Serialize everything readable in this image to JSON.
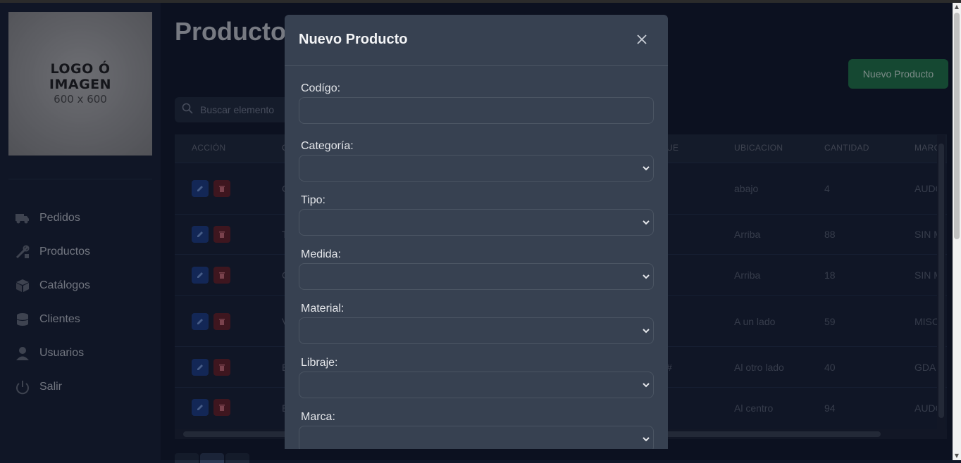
{
  "sidebar": {
    "logo": {
      "line1": "LOGO Ó",
      "line2": "IMAGEN",
      "line3": "600 x 600"
    },
    "items": [
      {
        "label": "Pedidos",
        "icon": "truck-icon"
      },
      {
        "label": "Productos",
        "icon": "tools-icon"
      },
      {
        "label": "Catálogos",
        "icon": "box-icon"
      },
      {
        "label": "Clientes",
        "icon": "database-icon"
      },
      {
        "label": "Usuarios",
        "icon": "user-icon"
      },
      {
        "label": "Salir",
        "icon": "power-icon"
      }
    ]
  },
  "main": {
    "title": "Productos",
    "new_button": "Nuevo Producto",
    "search_placeholder": "Buscar elemento",
    "columns": {
      "accion": "ACCIÓN",
      "c": "C",
      "ue": "UE",
      "ubicacion": "UBICACION",
      "cantidad": "CANTIDAD",
      "marca": "MARC"
    },
    "rows": [
      {
        "c": "C",
        "ue": "",
        "ubicacion": "abajo",
        "cantidad": "4",
        "marca": "AUDC"
      },
      {
        "c": "T",
        "ue": "",
        "ubicacion": "Arriba",
        "cantidad": "88",
        "marca": "SIN M"
      },
      {
        "c": "C",
        "ue": "",
        "ubicacion": "Arriba",
        "cantidad": "18",
        "marca": "SIN M"
      },
      {
        "c": "V",
        "ue": "",
        "ubicacion": "A un lado",
        "cantidad": "59",
        "marca": "MISC"
      },
      {
        "c": "E",
        "ue": "#",
        "ubicacion": "Al otro lado",
        "cantidad": "40",
        "marca": "GDA"
      },
      {
        "c": "E",
        "ue": "",
        "ubicacion": "Al centro",
        "cantidad": "94",
        "marca": "AUDC"
      }
    ]
  },
  "modal": {
    "title": "Nuevo Producto",
    "fields": [
      {
        "label": "Codígo:",
        "type": "text",
        "value": ""
      },
      {
        "label": "Categoría:",
        "type": "select",
        "value": ""
      },
      {
        "label": "Tipo:",
        "type": "select",
        "value": ""
      },
      {
        "label": "Medida:",
        "type": "select",
        "value": ""
      },
      {
        "label": "Material:",
        "type": "select",
        "value": ""
      },
      {
        "label": "Libraje:",
        "type": "select",
        "value": ""
      },
      {
        "label": "Marca:",
        "type": "select",
        "value": ""
      }
    ]
  },
  "colors": {
    "accent_green": "#1f7a49",
    "edit_blue": "#1d3f8a",
    "delete_red": "#6b1f27",
    "modal_bg": "#374151"
  }
}
